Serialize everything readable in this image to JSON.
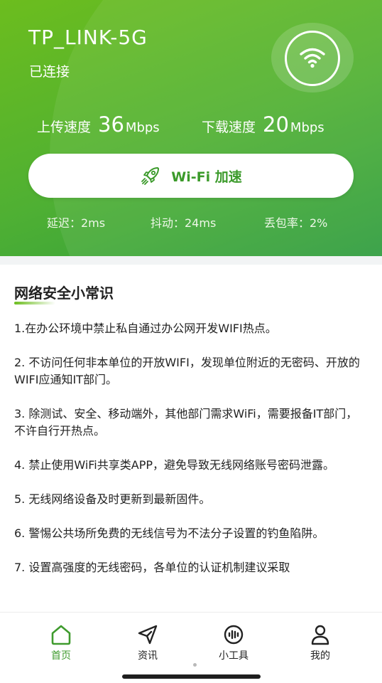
{
  "colors": {
    "accent": "#3f9b2e",
    "hero_start": "#6cbd1e",
    "hero_end": "#2f9d3f"
  },
  "network": {
    "ssid": "TP_LINK-5G",
    "status": "已连接",
    "icon": "wifi-icon"
  },
  "speed": {
    "upload_label": "上传速度",
    "upload_value": "36",
    "upload_unit": "Mbps",
    "download_label": "下载速度",
    "download_value": "20",
    "download_unit": "Mbps"
  },
  "boost": {
    "label": "Wi-Fi 加速",
    "icon": "rocket-icon"
  },
  "stats": {
    "latency": "延迟：2ms",
    "jitter": "抖动：24ms",
    "packet_loss": "丢包率：2%"
  },
  "tips": {
    "title": "网络安全小常识",
    "items": [
      "1.在办公环境中禁止私自通过办公网开发WIFI热点。",
      "2. 不访问任何非本单位的开放WIFI，发现单位附近的无密码、开放的WIFI应通知IT部门。",
      "3. 除测试、安全、移动端外，其他部门需求WiFi，需要报备IT部门，不许自行开热点。",
      "4. 禁止使用WiFi共享类APP，避免导致无线网络账号密码泄露。",
      "5. 无线网络设备及时更新到最新固件。",
      "6. 警惕公共场所免费的无线信号为不法分子设置的钓鱼陷阱。",
      "7. 设置高强度的无线密码，各单位的认证机制建议采取"
    ]
  },
  "tabbar": {
    "items": [
      {
        "label": "首页",
        "icon": "home-icon",
        "active": true
      },
      {
        "label": "资讯",
        "icon": "send-icon",
        "active": false
      },
      {
        "label": "小工具",
        "icon": "toolbox-icon",
        "active": false
      },
      {
        "label": "我的",
        "icon": "user-icon",
        "active": false
      }
    ]
  }
}
